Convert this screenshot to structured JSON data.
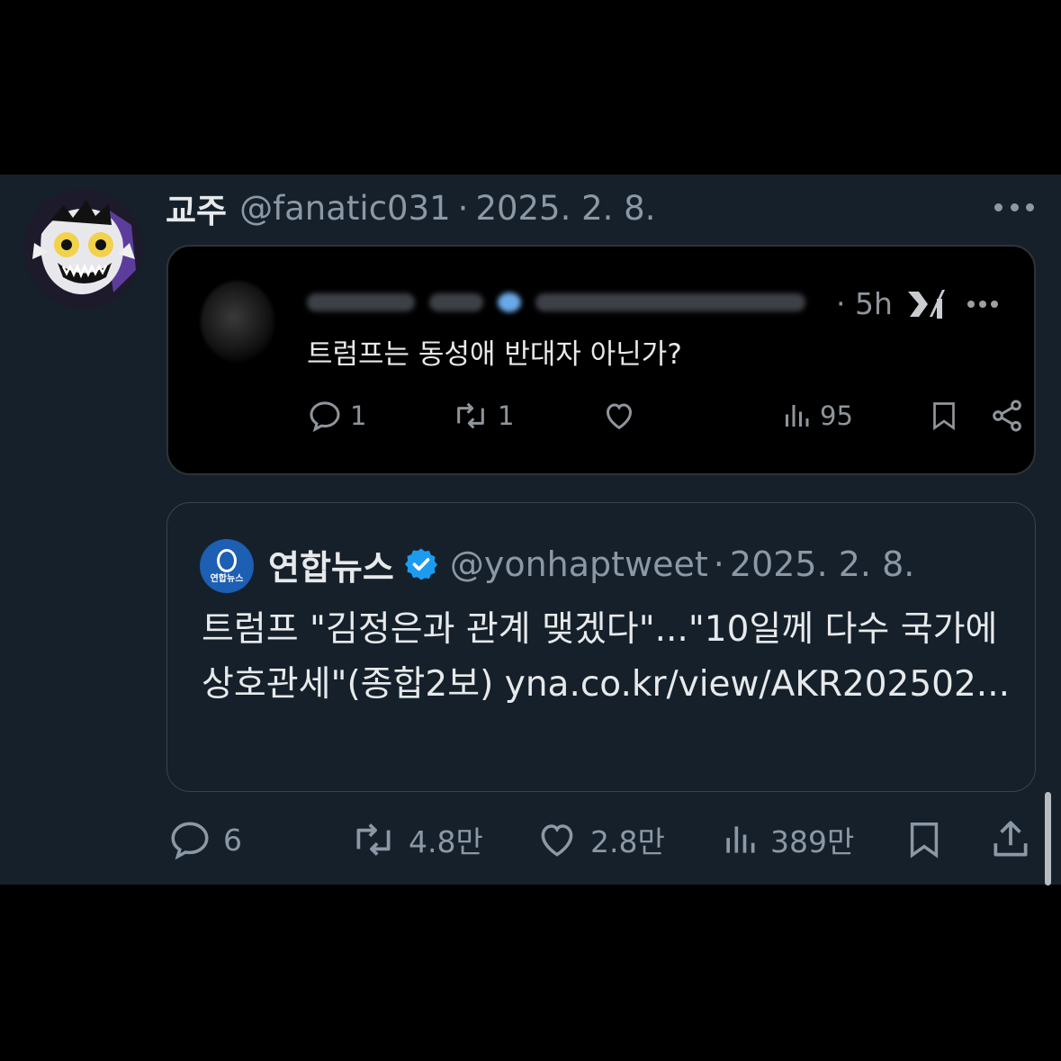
{
  "tweet": {
    "display_name": "교주",
    "handle": "@fanatic031",
    "separator": "·",
    "date": "2025. 2. 8."
  },
  "embedded_screenshot": {
    "time": "· 5h",
    "text": "트럼프는 동성애 반대자 아닌가?",
    "replies": "1",
    "reposts": "1",
    "views": "95"
  },
  "quoted_tweet": {
    "display_name": "연합뉴스",
    "handle": "@yonhaptweet",
    "separator": "·",
    "date": "2025. 2. 8.",
    "avatar_text": "연합뉴스",
    "text": "트럼프 \"김정은과 관계 맺겠다\"...\"10일께 다수 국가에 상호관세\"(종합2보) ",
    "link": "yna.co.kr/view/AKR202502..."
  },
  "actions": {
    "replies": "6",
    "reposts": "4.8만",
    "likes": "2.8만",
    "views": "389만"
  },
  "colors": {
    "background": "#15202b",
    "text_primary": "#e7e9ea",
    "text_secondary": "#8b98a5",
    "verified": "#1d9bf0",
    "border": "#38444d"
  }
}
